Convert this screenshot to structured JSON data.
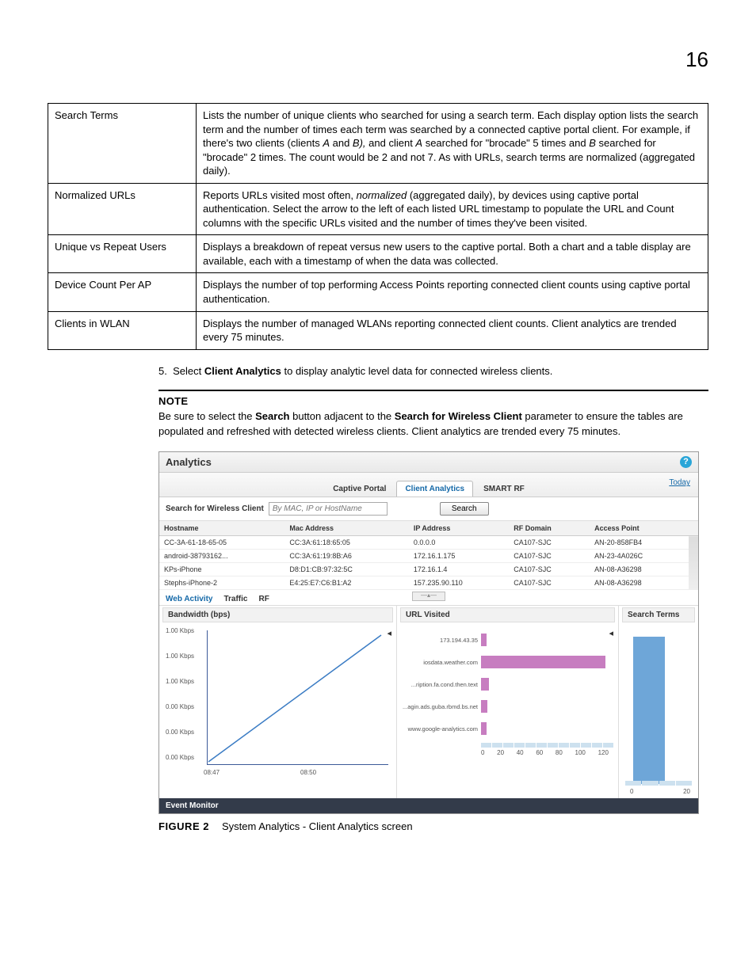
{
  "page_number": "16",
  "definitions": [
    {
      "term": "Search Terms",
      "desc_parts": [
        "Lists the number of unique clients who searched for using a search term. Each display option lists the search term and the number of times each term was searched by a connected captive portal client. For example, if there's two clients (clients ",
        "A",
        " and ",
        "B),",
        "  and client ",
        "A",
        " searched for \"brocade\" 5 times and ",
        "B",
        " searched for \"brocade\" 2 times. The count would be 2 and not 7. As with URLs, search terms are normalized (aggregated daily)."
      ]
    },
    {
      "term": "Normalized URLs",
      "desc_parts": [
        "Reports URLs visited most often, ",
        "normalized",
        " (aggregated daily), by devices using captive portal authentication. Select the arrow to the left of each listed URL timestamp to populate the URL and Count columns with the specific URLs visited and the number of times they've been visited."
      ]
    },
    {
      "term": "Unique vs Repeat Users",
      "desc": "Displays a breakdown of repeat versus new users to the captive portal. Both a chart and a table display are available, each with a timestamp of when the data was collected."
    },
    {
      "term": "Device Count Per AP",
      "desc": "Displays the number of top performing Access Points reporting connected client counts using captive portal authentication."
    },
    {
      "term": "Clients in WLAN",
      "desc": "Displays the number of managed WLANs reporting connected client counts. Client analytics are trended every 75 minutes."
    }
  ],
  "step": {
    "num": "5.",
    "pre": "Select ",
    "bold": "Client Analytics",
    "post": " to display analytic level data for connected wireless clients."
  },
  "note": {
    "title": "NOTE",
    "p1": "Be sure to select the ",
    "b1": "Search",
    "p2": " button adjacent to the ",
    "b2": "Search for Wireless Client",
    "p3": " parameter to ensure the tables are populated and refreshed with detected wireless clients. Client analytics are trended every 75 minutes."
  },
  "shot": {
    "title": "Analytics",
    "tabs": {
      "t1": "Captive Portal",
      "t2": "Client Analytics",
      "t3": "SMART RF"
    },
    "today": "Today",
    "search_label": "Search for Wireless Client",
    "search_placeholder": "By MAC, IP or HostName",
    "search_btn": "Search",
    "cols": {
      "c1": "Hostname",
      "c2": "Mac Address",
      "c3": "IP Address",
      "c4": "RF Domain",
      "c5": "Access Point"
    },
    "rows": [
      {
        "h": "CC-3A-61-18-65-05",
        "m": "CC:3A:61:18:65:05",
        "ip": "0.0.0.0",
        "rf": "CA107-SJC",
        "ap": "AN-20-858FB4"
      },
      {
        "h": "android-38793162...",
        "m": "CC:3A:61:19:8B:A6",
        "ip": "172.16.1.175",
        "rf": "CA107-SJC",
        "ap": "AN-23-4A026C"
      },
      {
        "h": "KPs-iPhone",
        "m": "D8:D1:CB:97:32:5C",
        "ip": "172.16.1.4",
        "rf": "CA107-SJC",
        "ap": "AN-08-A36298"
      },
      {
        "h": "Stephs-iPhone-2",
        "m": "E4:25:E7:C6:B1:A2",
        "ip": "157.235.90.110",
        "rf": "CA107-SJC",
        "ap": "AN-08-A36298"
      }
    ],
    "subtabs": {
      "s1": "Web Activity",
      "s2": "Traffic",
      "s3": "RF"
    },
    "bw_title": "Bandwidth (bps)",
    "url_title": "URL Visited",
    "st_title": "Search Terms",
    "event_monitor": "Event Monitor"
  },
  "chart_data": [
    {
      "type": "line",
      "title": "Bandwidth (bps)",
      "x": [
        "08:47",
        "08:50"
      ],
      "y_ticks": [
        "0.00 Kbps",
        "0.00 Kbps",
        "0.00 Kbps",
        "1.00 Kbps",
        "1.00 Kbps",
        "1.00 Kbps"
      ],
      "series": [
        {
          "name": "bandwidth",
          "values_relative": [
            0.02,
            0.98
          ]
        }
      ],
      "xlabel": "",
      "ylabel": ""
    },
    {
      "type": "bar",
      "orientation": "horizontal",
      "title": "URL Visited",
      "categories": [
        "173.194.43.35",
        "iosdata.weather.com",
        "...ription.fa.cond.then.text",
        "...agin.ads.guba.rbmd.bs.net",
        "www.google-analytics.com"
      ],
      "values": [
        5,
        115,
        8,
        6,
        5
      ],
      "xlim": [
        0,
        120
      ],
      "x_ticks": [
        0,
        20,
        40,
        60,
        80,
        100,
        120
      ]
    },
    {
      "type": "bar",
      "title": "Search Terms",
      "categories": [
        ""
      ],
      "values": [
        20
      ],
      "xlim": [
        0,
        20
      ],
      "x_ticks": [
        0,
        20
      ]
    }
  ],
  "figure": {
    "label": "FIGURE 2",
    "caption": "System Analytics - Client Analytics screen"
  }
}
